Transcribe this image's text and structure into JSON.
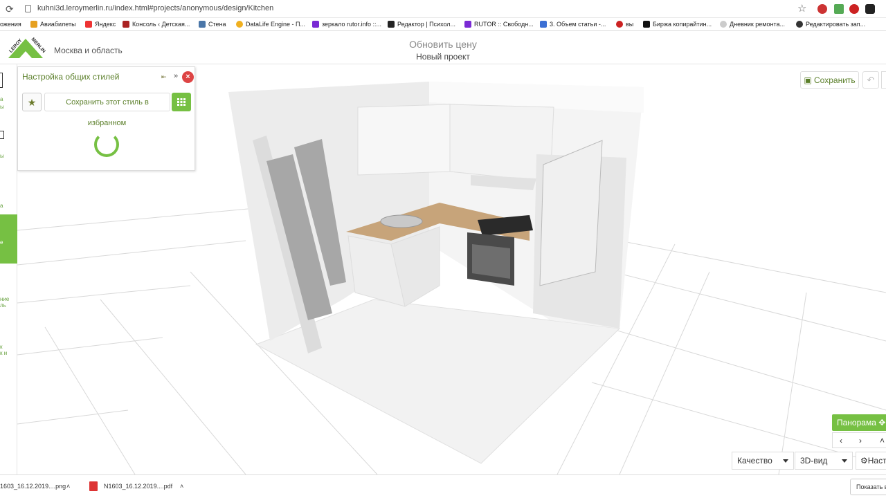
{
  "browser": {
    "url": "kuhni3d.leroymerlin.ru/index.html#projects/anonymous/design/Kitchen",
    "bookmarks": [
      "ожения",
      "Авиабилеты",
      "Яндекс",
      "Консоль ‹ Детская...",
      "Стена",
      "DataLife Engine - П...",
      "зеркало rutor.info ::...",
      "Редактор | Психол...",
      "RUTOR :: Свободн...",
      "3. Объем статьи -...",
      "вы",
      "Биржа копирайтин...",
      "Дневник ремонта...",
      "Редактировать зап..."
    ]
  },
  "header": {
    "logo_text": "LEROY MERLIN",
    "region": "Москва и область",
    "update_price": "Обновить цену",
    "project_name": "Новый проект"
  },
  "rail": {
    "fragments": [
      "а",
      "ы",
      "ы",
      "а",
      "е",
      "ние",
      "ль",
      "к",
      "к и"
    ]
  },
  "style_panel": {
    "title": "Настройка общих стилей",
    "save_style": "Сохранить этот стиль в",
    "favorites": "избранном"
  },
  "toolbar": {
    "save": "Сохранить",
    "panorama": "Панорама",
    "quality": "Качество",
    "view": "3D-вид",
    "settings": "Наст"
  },
  "downloads": {
    "file1": "1603_16.12.2019....png",
    "file2": "N1603_16.12.2019....pdf",
    "show_all": "Показать в"
  },
  "colors": {
    "accent": "#76c043",
    "close": "#dd4444"
  }
}
